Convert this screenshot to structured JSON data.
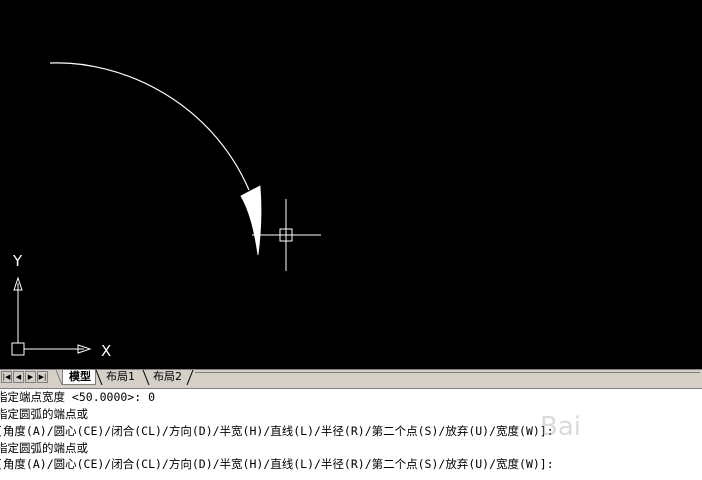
{
  "canvas": {
    "ucs_x_label": "X",
    "ucs_y_label": "Y",
    "background_color": "#000000",
    "drawing_color": "#ffffff"
  },
  "tabs": {
    "nav_icons": [
      "first-tab-icon",
      "prev-tab-icon",
      "next-tab-icon",
      "last-tab-icon"
    ],
    "items": [
      {
        "label": "模型",
        "active": true
      },
      {
        "label": "布局1",
        "active": false
      },
      {
        "label": "布局2",
        "active": false
      }
    ]
  },
  "command": {
    "lines": [
      "指定端点宽度 <50.0000>: 0",
      "指定圆弧的端点或",
      "[角度(A)/圆心(CE)/闭合(CL)/方向(D)/半宽(H)/直线(L)/半径(R)/第二个点(S)/放弃(U)/宽度(W)]:",
      "指定圆弧的端点或",
      "[角度(A)/圆心(CE)/闭合(CL)/方向(D)/半宽(H)/直线(L)/半径(R)/第二个点(S)/放弃(U)/宽度(W)]:"
    ]
  },
  "watermark": {
    "text": "Bai"
  }
}
